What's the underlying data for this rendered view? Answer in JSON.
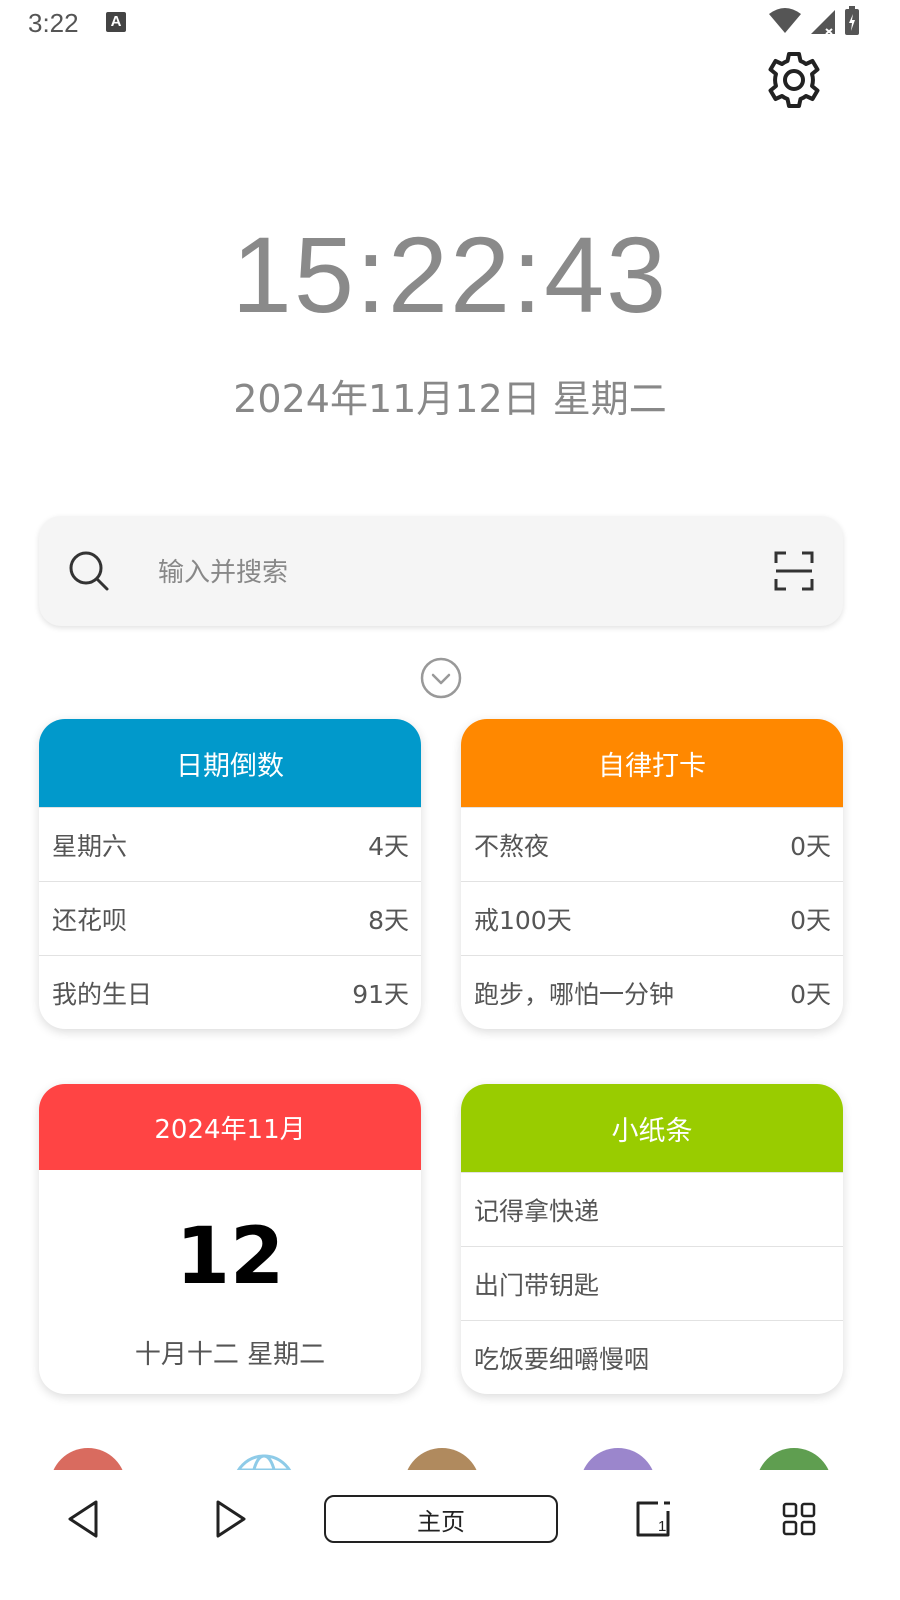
{
  "status_bar": {
    "time": "3:22",
    "badge": "A"
  },
  "clock": {
    "time": "15:22:43",
    "date": "2024年11月12日 星期二"
  },
  "search": {
    "placeholder": "输入并搜索"
  },
  "countdown_card": {
    "title": "日期倒数",
    "color": "#0199cb",
    "rows": [
      {
        "label": "星期六",
        "value": "4天"
      },
      {
        "label": "还花呗",
        "value": "8天"
      },
      {
        "label": "我的生日",
        "value": "91天"
      }
    ]
  },
  "checkin_card": {
    "title": "自律打卡",
    "color": "#ff8800",
    "rows": [
      {
        "label": "不熬夜",
        "value": "0天"
      },
      {
        "label": "戒100天",
        "value": "0天"
      },
      {
        "label": "跑步，哪怕一分钟",
        "value": "0天"
      }
    ]
  },
  "calendar_card": {
    "title": "2024年11月",
    "color": "#ff4444",
    "day": "12",
    "lunar": "十月十二  星期二"
  },
  "notes_card": {
    "title": "小纸条",
    "color": "#99cc00",
    "rows": [
      {
        "label": "记得拿快递"
      },
      {
        "label": "出门带钥匙"
      },
      {
        "label": "吃饭要细嚼慢咽"
      }
    ]
  },
  "app_colors": [
    "#d96b5f",
    "#8ecbe8",
    "#b08a5e",
    "#9b86cc",
    "#5f9e50"
  ],
  "nav": {
    "home_label": "主页",
    "recents_count": "1"
  }
}
